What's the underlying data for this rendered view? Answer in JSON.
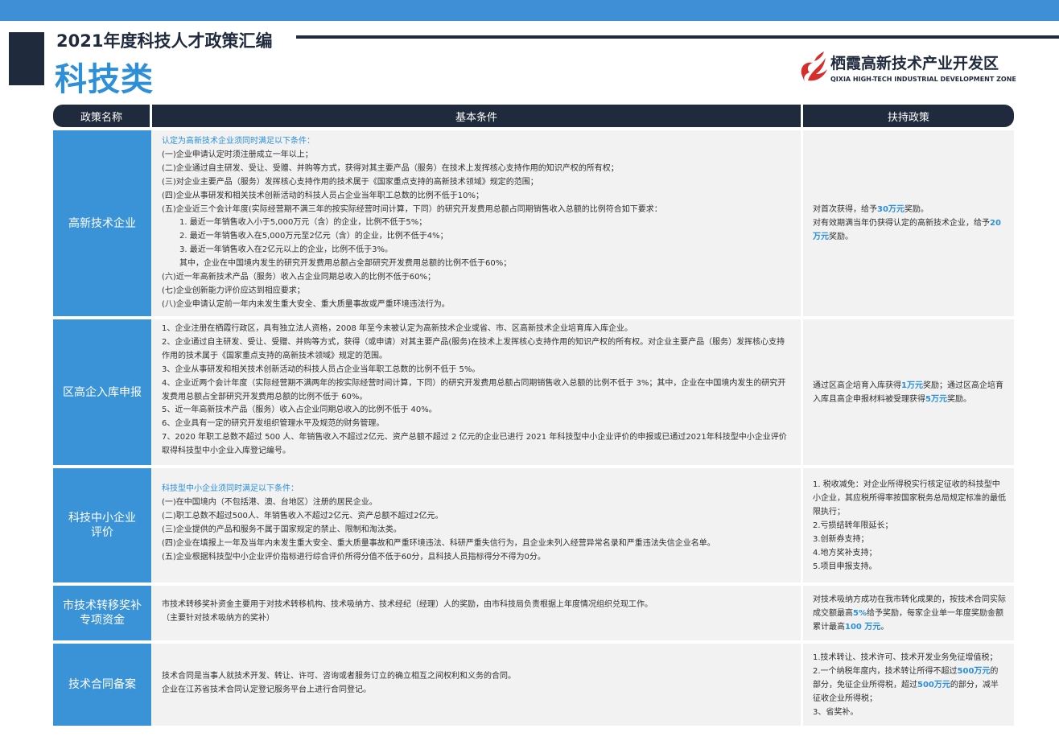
{
  "header": {
    "year_title": "2021年度科技人才政策汇编",
    "category_title": "科技类",
    "logo_cn": "栖霞高新技术产业开发区",
    "logo_en": "QIXIA HIGH-TECH INDUSTRIAL DEVELOPMENT ZONE"
  },
  "table": {
    "col_name": "政策名称",
    "col_conditions": "基本条件",
    "col_support": "扶持政策"
  },
  "rows": [
    {
      "name": "高新技术企业",
      "cond_intro": "认定为高新技术企业须同时满足以下条件：",
      "cond_lines": [
        "(一)企业申请认定时须注册成立一年以上；",
        "(二)企业通过自主研发、受让、受赠、并购等方式，获得对其主要产品（服务）在技术上发挥核心支持作用的知识产权的所有权；",
        "(三)对企业主要产品（服务）发挥核心支持作用的技术属于《国家重点支持的高新技术领域》规定的范围；",
        "(四)企业从事研发和相关技术创新活动的科技人员占企业当年职工总数的比例不低于10%；",
        "(五)企业近三个会计年度(实际经营期不满三年的按实际经营时间计算，下同）的研究开发费用总额占同期销售收入总额的比例符合如下要求：",
        "1. 最近一年销售收入小于5,000万元（含）的企业，比例不低于5%；",
        "2. 最近一年销售收入在5,000万元至2亿元（含）的企业，比例不低于4%；",
        "3. 最近一年销售收入在2亿元以上的企业，比例不低于3%。",
        "其中，企业在中国境内发生的研究开发费用总额占全部研究开发费用总额的比例不低于60%；",
        "(六)近一年高新技术产品（服务）收入占企业同期总收入的比例不低于60%；",
        "(七)企业创新能力评价应达到相应要求；",
        "(八)企业申请认定前一年内未发生重大安全、重大质量事故或严重环境违法行为。"
      ],
      "sup": {
        "l1_pre": "对首次获得，给予",
        "l1_amt": "30万元",
        "l1_post": "奖励。",
        "l2_pre": "对有效期满当年仍获得认定的高新技术企业，给予",
        "l2_amt": "20万元",
        "l2_post": "奖励。"
      }
    },
    {
      "name": "区高企入库申报",
      "cond_lines": [
        "1、企业注册在栖霞行政区，具有独立法人资格，2008 年至今未被认定为高新技术企业或省、市、区高新技术企业培育库入库企业。",
        "2、企业通过自主研发、受让、受赠、并购等方式，获得（或申请）对其主要产品(服务)在技术上发挥核心支持作用的知识产权的所有权。对企业主要产品（服务）发挥核心支持作用的技术属于《国家重点支持的高新技术领域》规定的范围。",
        "3、企业从事研发和相关技术创新活动的科技人员占企业当年职工总数的比例不低于 5%。",
        "4、企业近两个会计年度（实际经营期不满两年的按实际经营时间计算，下同）的研究开发费用总额占同期销售收入总额的比例不低于 3%；其中，企业在中国境内发生的研究开发费用总额占全部研究开发费用总额的比例不低于 60%。",
        "5、近一年高新技术产品（服务）收入占企业同期总收入的比例不低于 40%。",
        "6、企业具有一定的研究开发组织管理水平及规范的财务管理。",
        "7、2020 年职工总数不超过 500 人、年销售收入不超过2亿元、资产总额不超过 2 亿元的企业已进行 2021 年科技型中小企业评价的申报或已通过2021年科技型中小企业评价取得科技型中小企业入库登记编号。"
      ],
      "sup": {
        "pre": "通过区高企培育入库获得",
        "amt1": "1万元",
        "mid": "奖励；通过区高企培育入库且高企申报材料被受理获得",
        "amt2": "5万元",
        "post": "奖励。"
      }
    },
    {
      "name": "科技中小企业评价",
      "cond_intro": "科技型中小企业须同时满足以下条件：",
      "cond_lines": [
        "(一)在中国境内（不包括港、澳、台地区）注册的居民企业。",
        "(二)职工总数不超过500人、年销售收入不超过2亿元、资产总额不超过2亿元。",
        "(三)企业提供的产品和服务不属于国家规定的禁止、限制和淘汰类。",
        "(四)企业在填报上一年及当年内未发生重大安全、重大质量事故和严重环境违法、科研严重失信行为，且企业未列入经营异常名录和严重违法失信企业名单。",
        "(五)企业根据科技型中小企业评价指标进行综合评价所得分值不低于60分，且科技人员指标得分不得为0分。"
      ],
      "sup_lines": [
        "1.  税收减免：对企业所得税实行核定征收的科技型中小企业，其应税所得率按国家税务总局规定标准的最低限执行；",
        "2.亏损结转年限延长；",
        "3.创新券支持；",
        "4.地方奖补支持；",
        "5.项目申报支持。"
      ]
    },
    {
      "name": "市技术转移奖补专项资金",
      "cond_lines": [
        "市技术转移奖补资金主要用于对技术转移机构、技术吸纳方、技术经纪（经理）人的奖励，由市科技局负责根据上年度情况组织兑现工作。",
        "（主要针对技术吸纳方的奖补）"
      ],
      "sup": {
        "pre": "对技术吸纳方成功在我市转化成果的，按技术合同实际成交额最高",
        "amt1": "5%",
        "mid": "给予奖励，每家企业单一年度奖励金额累计最高",
        "amt2": "100 万元",
        "post": "。"
      }
    },
    {
      "name": "技术合同备案",
      "cond_lines": [
        "技术合同是当事人就技术开发、转让、许可、咨询或者服务订立的确立相互之间权利和义务的合同。",
        "企业在江苏省技术合同认定登记服务平台上进行合同登记。"
      ],
      "sup": {
        "l1": "1.技术转让、技术许可、技术开发业务免征增值税；",
        "l2_pre": "2.一个纳税年度内，技术转让所得不超过",
        "l2_amt": "500万元",
        "l2_mid": "的部分，免征企业所得税，超过",
        "l2_amt2": "500万元",
        "l2_post": "的部分，减半征收企业所得税；",
        "l3": "3、省奖补。"
      }
    }
  ]
}
